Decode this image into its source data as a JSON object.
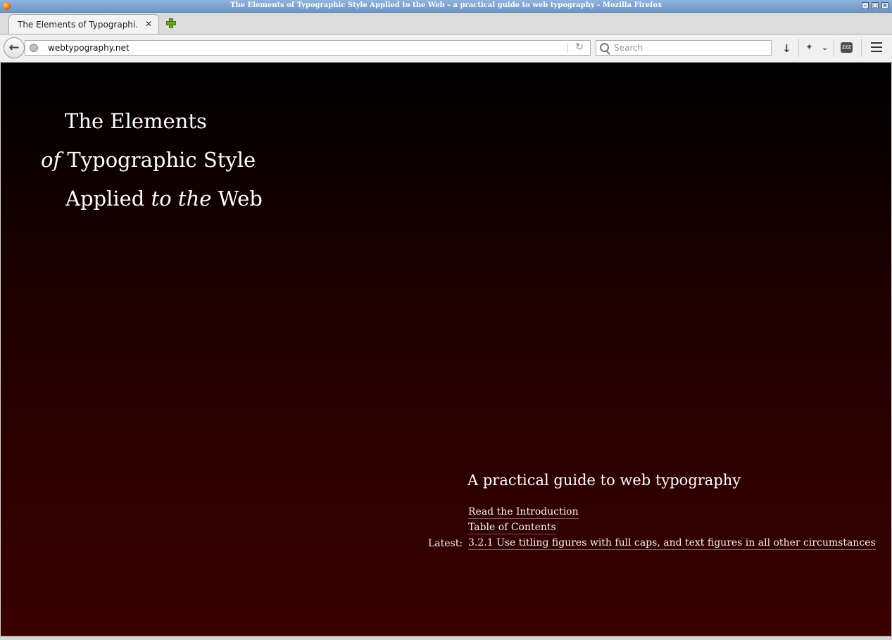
{
  "window": {
    "title": "The Elements of Typographic Style Applied to the Web – a practical guide to web typography - Mozilla Firefox"
  },
  "tab": {
    "label": "The Elements of Typographi…",
    "close": "✕",
    "new_tab_icon": "plus-icon"
  },
  "navbar": {
    "back": "←",
    "url": "webtypography.net",
    "reload": "↻",
    "search_placeholder": "Search",
    "download": "↓",
    "zzz": "ZZZ"
  },
  "page": {
    "title_line1": "The Elements",
    "title_line2_italic": "of",
    "title_line2": "Typographic Style",
    "title_line3_a": "Applied",
    "title_line3_italic": "to the",
    "title_line3_b": "Web",
    "tagline": "A practical guide to web typography",
    "intro_link": "Read the Introduction",
    "toc_link": "Table of Contents",
    "latest_label": "Latest:",
    "latest_link": "3.2.1 Use titling figures with full caps, and text figures in all other circumstances"
  },
  "colors": {
    "background_top": "#000000",
    "background_bottom": "#3a0000",
    "text": "#ffffff"
  }
}
